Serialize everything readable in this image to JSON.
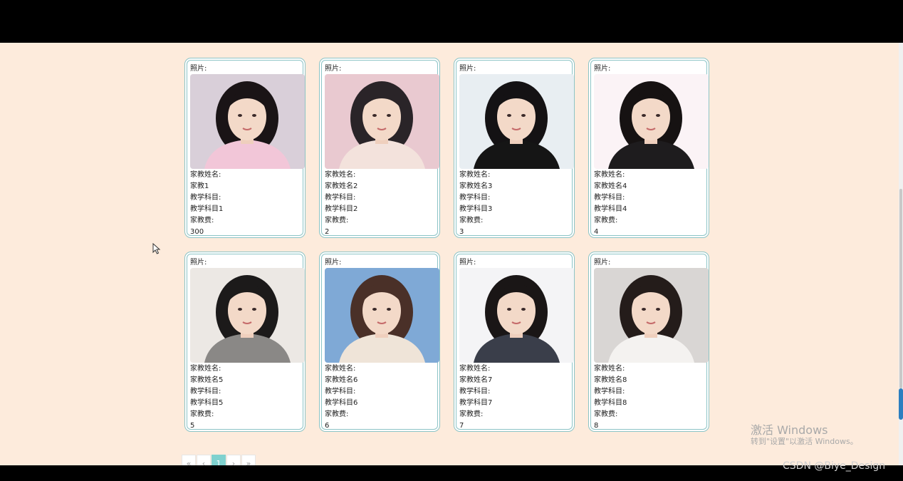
{
  "labels": {
    "photo": "照片:",
    "name": "家教姓名:",
    "subject": "教学科目:",
    "fee": "家教费:"
  },
  "cards": [
    {
      "name": "家教1",
      "subject": "教学科目1",
      "fee": "300",
      "photo": "photo-girl-pink-hoodie",
      "bg": "#d9cfd9",
      "hair": "#1a1416",
      "cloth": "#f2c6d8"
    },
    {
      "name": "家教姓名2",
      "subject": "教学科目2",
      "fee": "2",
      "photo": "photo-girl-braids",
      "bg": "#e9c9d0",
      "hair": "#2a2428",
      "cloth": "#f3e2dc"
    },
    {
      "name": "家教姓名3",
      "subject": "教学科目3",
      "fee": "3",
      "photo": "photo-girl-black-dress",
      "bg": "#e8eef2",
      "hair": "#141214",
      "cloth": "#151515"
    },
    {
      "name": "家教姓名4",
      "subject": "教学科目4",
      "fee": "4",
      "photo": "photo-man-black-shirt",
      "bg": "#fbf3f6",
      "hair": "#161212",
      "cloth": "#1e1c1e"
    },
    {
      "name": "家教姓名5",
      "subject": "教学科目5",
      "fee": "5",
      "photo": "photo-girl-grey-sweater",
      "bg": "#ece8e4",
      "hair": "#1c1a1a",
      "cloth": "#8a8886"
    },
    {
      "name": "家教姓名6",
      "subject": "教学科目6",
      "fee": "6",
      "photo": "photo-girl-blue-sky",
      "bg": "#7fa9d6",
      "hair": "#4a3028",
      "cloth": "#efe4d8"
    },
    {
      "name": "家教姓名7",
      "subject": "教学科目7",
      "fee": "7",
      "photo": "photo-man-suit",
      "bg": "#f4f4f6",
      "hair": "#1a1616",
      "cloth": "#3a3e4a"
    },
    {
      "name": "家教姓名8",
      "subject": "教学科目8",
      "fee": "8",
      "photo": "photo-girl-pillow",
      "bg": "#d9d6d4",
      "hair": "#241c1a",
      "cloth": "#f4f2f0"
    }
  ],
  "pagination": {
    "first": "«",
    "prev": "‹",
    "current": "1",
    "next": "›",
    "last": "»"
  },
  "watermark": {
    "title": "激活 Windows",
    "subtitle": "转到\"设置\"以激活 Windows。"
  },
  "credit": "CSDN @Biye_Design"
}
